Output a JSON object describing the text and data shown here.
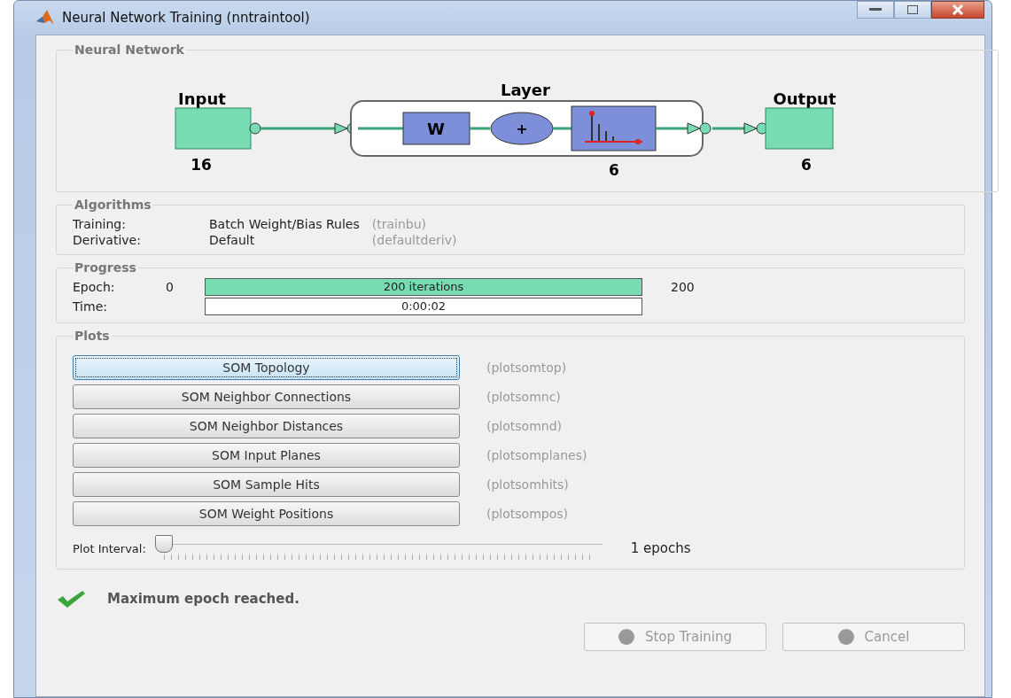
{
  "window": {
    "title": "Neural Network Training (nntraintool)"
  },
  "neural_network": {
    "title": "Neural Network",
    "input": {
      "label": "Input",
      "size": "16"
    },
    "layer": {
      "label": "Layer",
      "weight": "W",
      "sum": "+",
      "size": "6"
    },
    "output": {
      "label": "Output",
      "size": "6"
    }
  },
  "algorithms": {
    "title": "Algorithms",
    "rows": [
      {
        "label": "Training:",
        "value": "Batch Weight/Bias Rules",
        "function": "(trainbu)"
      },
      {
        "label": "Derivative:",
        "value": "Default",
        "function": "(defaultderiv)"
      }
    ]
  },
  "progress": {
    "title": "Progress",
    "rows": [
      {
        "kind": "bar",
        "label": "Epoch:",
        "start": "0",
        "text": "200 iterations",
        "end": "200",
        "level": 1
      },
      {
        "kind": "field",
        "label": "Time:",
        "text": "0:00:02"
      }
    ]
  },
  "plots": {
    "title": "Plots",
    "buttons": [
      {
        "label": "SOM Topology",
        "function": "(plotsomtop)",
        "focused": true
      },
      {
        "label": "SOM Neighbor Connections",
        "function": "(plotsomnc)",
        "focused": false
      },
      {
        "label": "SOM Neighbor Distances",
        "function": "(plotsomnd)",
        "focused": false
      },
      {
        "label": "SOM Input Planes",
        "function": "(plotsomplanes)",
        "focused": false
      },
      {
        "label": "SOM Sample Hits",
        "function": "(plotsomhits)",
        "focused": false
      },
      {
        "label": "SOM Weight Positions",
        "function": "(plotsompos)",
        "focused": false
      }
    ],
    "interval": {
      "label": "Plot Interval:",
      "level": 0,
      "reading": "1 epochs"
    }
  },
  "status": {
    "message": "Maximum epoch reached."
  },
  "buttons": [
    {
      "label": "Stop Training",
      "disabled": true
    },
    {
      "label": "Cancel",
      "disabled": true
    }
  ]
}
